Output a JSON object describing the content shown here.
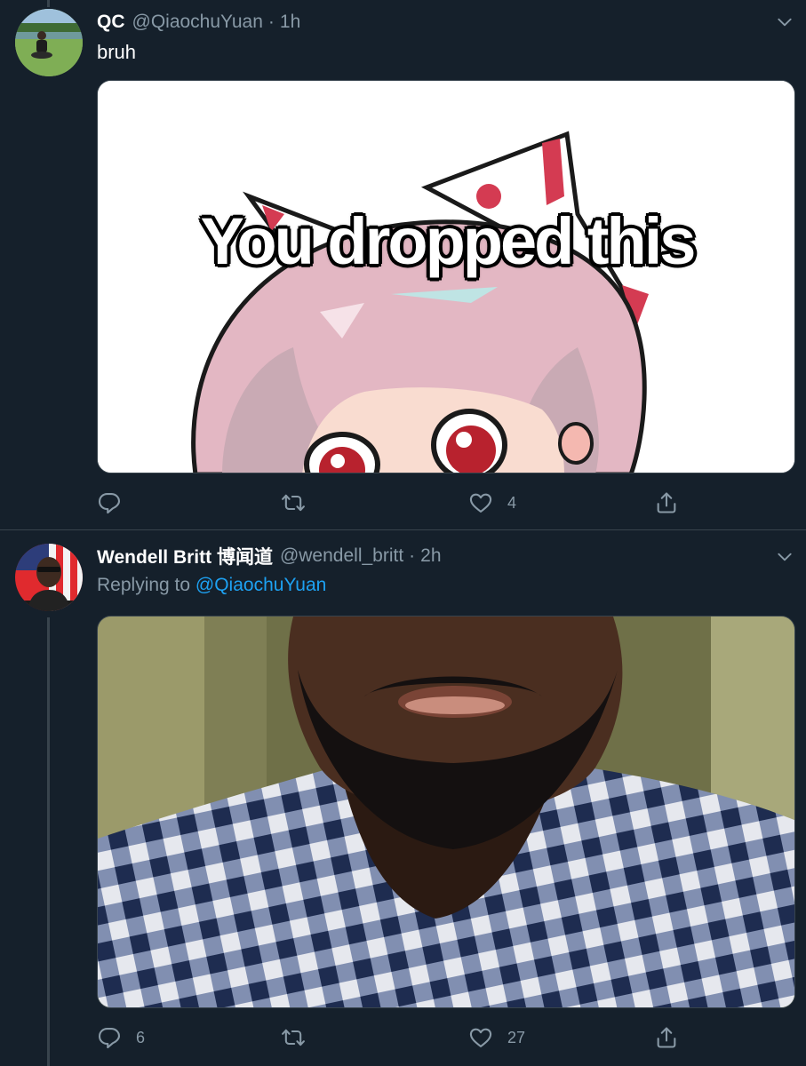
{
  "tweets": [
    {
      "name": "QC",
      "handle": "@QiaochuYuan",
      "separator": "·",
      "time": "1h",
      "text": "bruh",
      "media": {
        "caption": "You dropped this"
      },
      "actions": {
        "reply_count": "",
        "retweet_count": "",
        "like_count": "4"
      }
    },
    {
      "name": "Wendell Britt 博闻道",
      "handle": "@wendell_britt",
      "separator": "·",
      "time": "2h",
      "replying_prefix": "Replying to",
      "replying_to": "@QiaochuYuan",
      "actions": {
        "reply_count": "6",
        "retweet_count": "",
        "like_count": "27"
      }
    }
  ],
  "colors": {
    "background": "#15202b",
    "secondary_text": "#8899a6",
    "accent": "#1da1f2",
    "divider": "#38444d"
  },
  "icons": [
    "chevron-down-icon",
    "reply-icon",
    "retweet-icon",
    "like-icon",
    "share-icon"
  ]
}
